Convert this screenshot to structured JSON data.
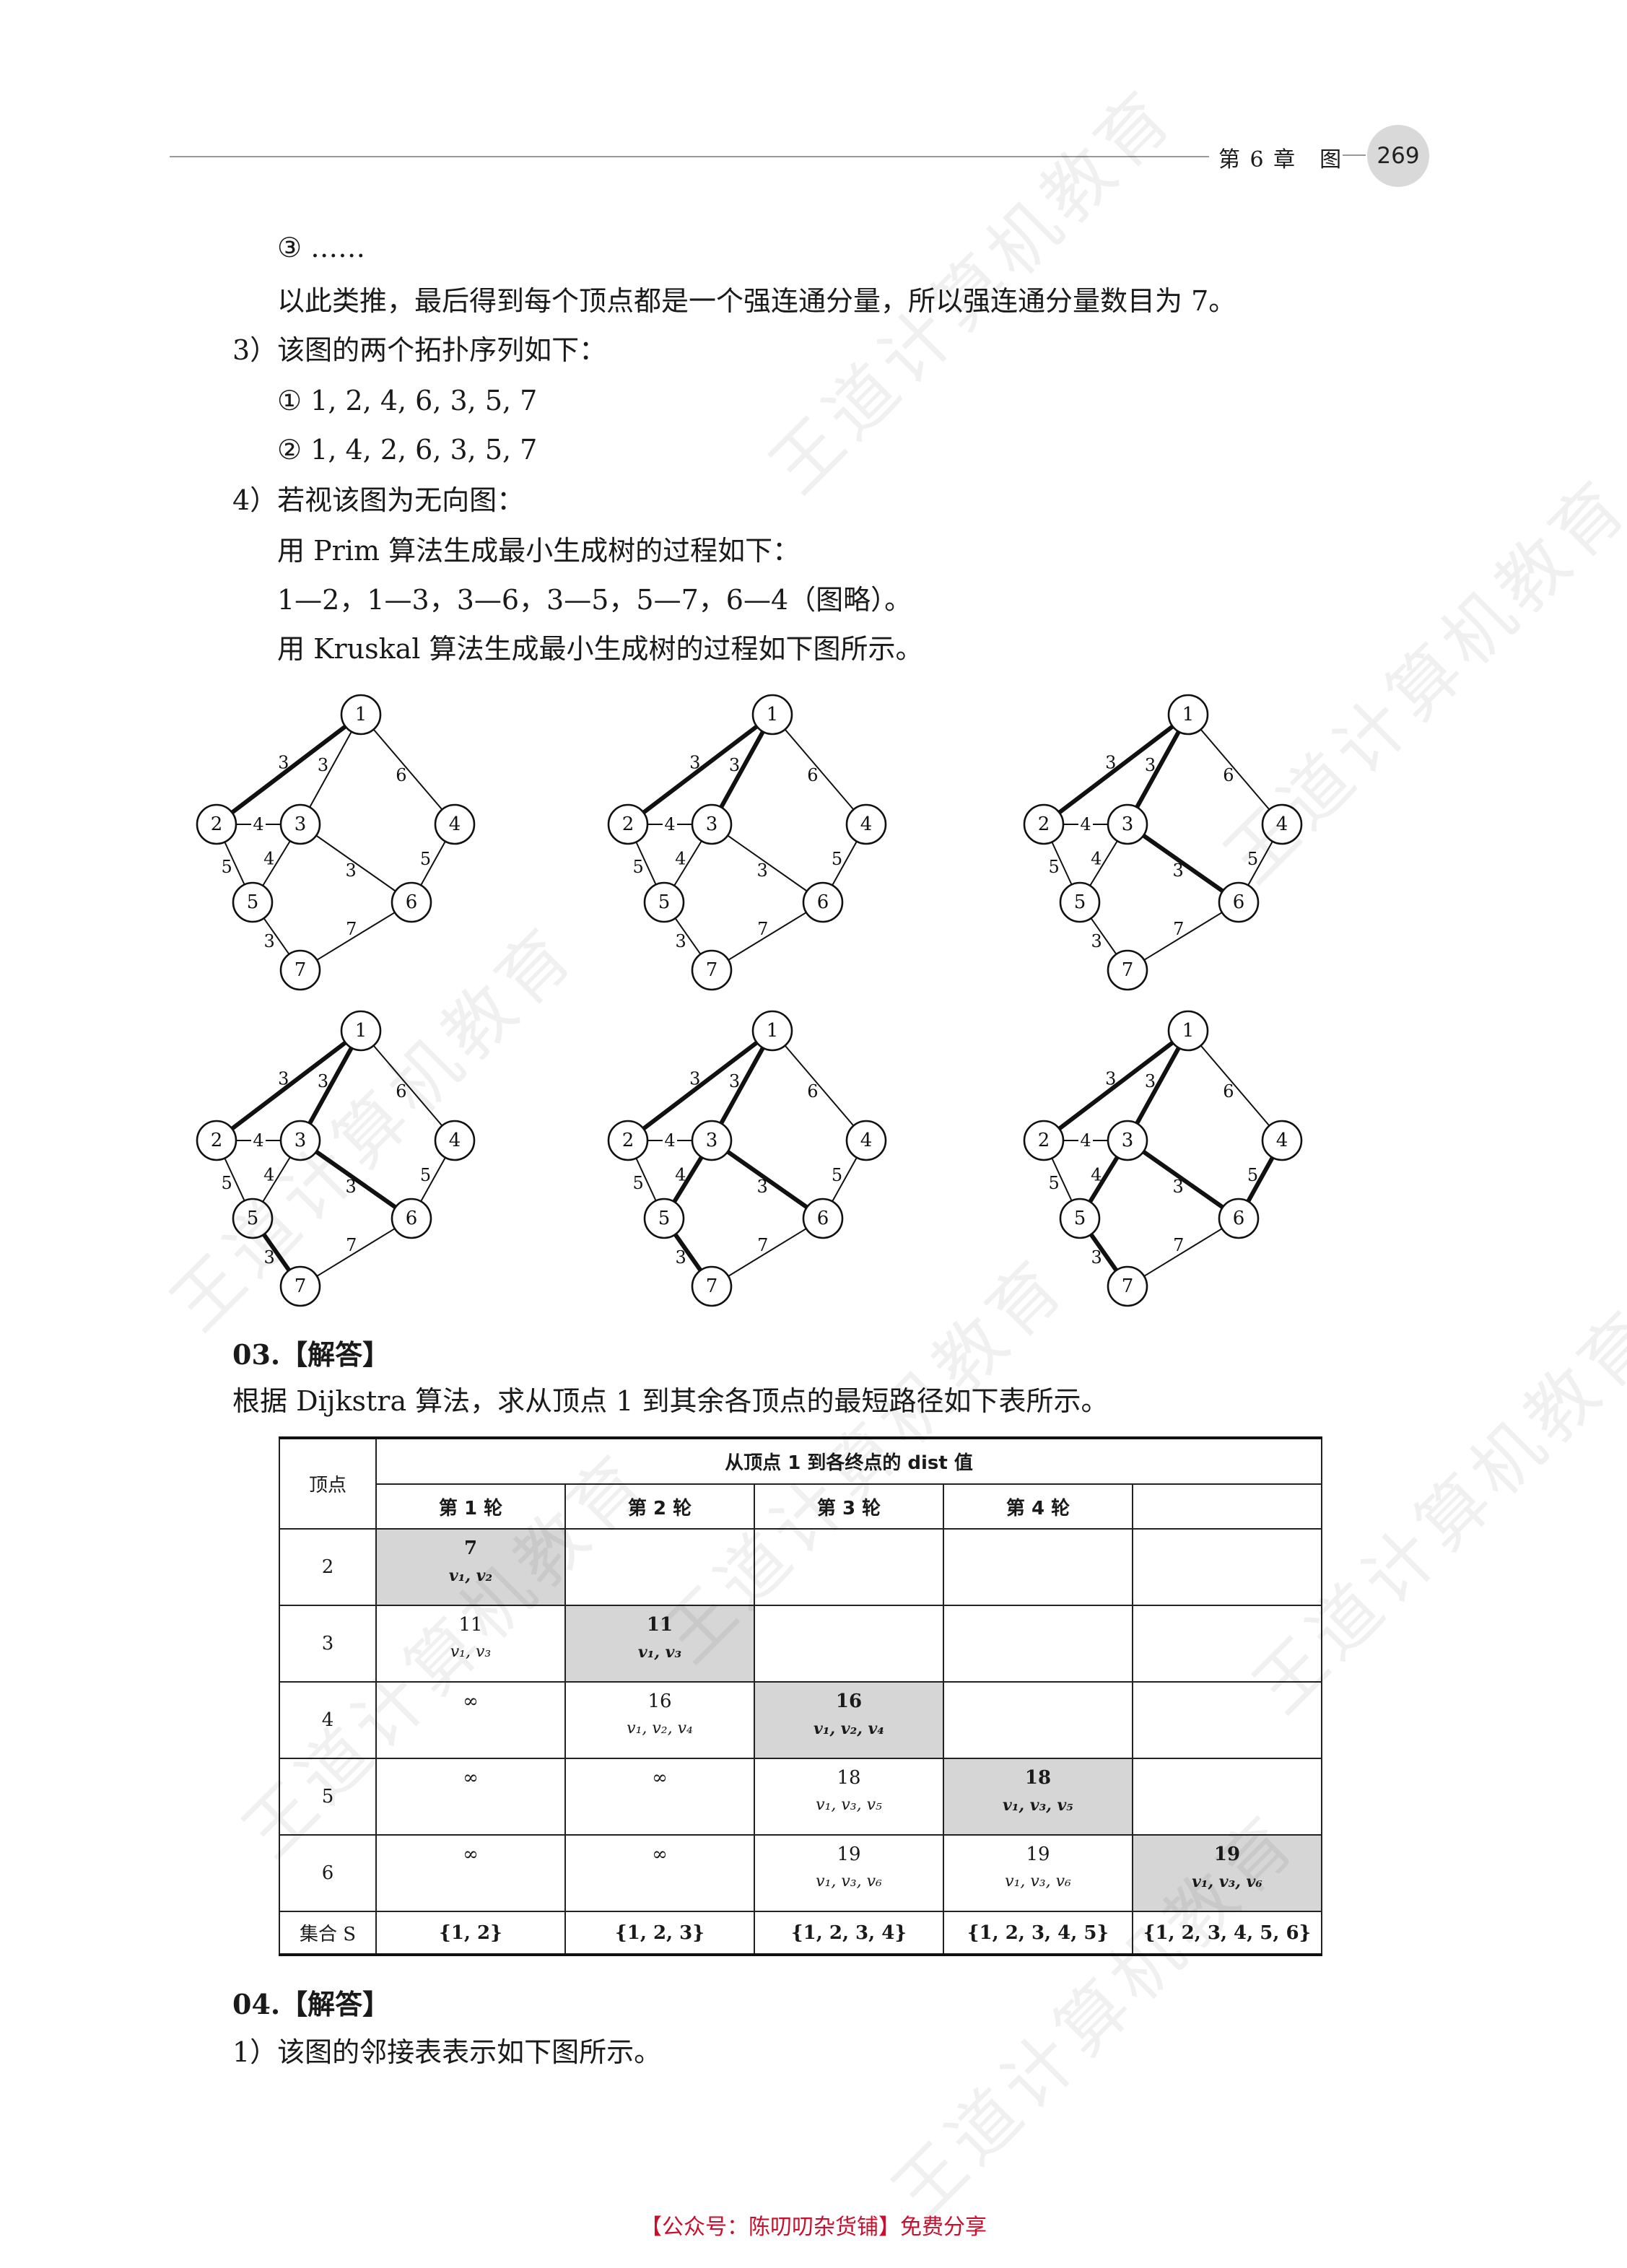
{
  "header": {
    "chapter": "第 6 章　图",
    "page_number": "269"
  },
  "lines": {
    "l1": "③ ……",
    "l2": "以此类推，最后得到每个顶点都是一个强连通分量，所以强连通分量数目为 7。",
    "l3": "3）该图的两个拓扑序列如下：",
    "l4": "① 1, 2, 4, 6, 3, 5, 7",
    "l5": "② 1, 4, 2, 6, 3, 5, 7",
    "l6": "4）若视该图为无向图：",
    "l7": "用 Prim 算法生成最小生成树的过程如下：",
    "l8": "1—2，1—3，3—6，3—5，5—7，6—4（图略）。",
    "l9": "用 Kruskal 算法生成最小生成树的过程如下图所示。",
    "q03": "03.【解答】",
    "q03_text": "根据 Dijkstra 算法，求从顶点 1 到其余各顶点的最短路径如下表所示。",
    "q04": "04.【解答】",
    "q04_text": "1）该图的邻接表表示如下图所示。"
  },
  "graph": {
    "nodes": [
      "1",
      "2",
      "3",
      "4",
      "5",
      "6",
      "7"
    ],
    "edges": [
      {
        "a": "1",
        "b": "2",
        "w": "3"
      },
      {
        "a": "1",
        "b": "3",
        "w": "3"
      },
      {
        "a": "1",
        "b": "4",
        "w": "6"
      },
      {
        "a": "2",
        "b": "3",
        "w": "4"
      },
      {
        "a": "2",
        "b": "5",
        "w": "5"
      },
      {
        "a": "3",
        "b": "5",
        "w": "4"
      },
      {
        "a": "3",
        "b": "6",
        "w": "3"
      },
      {
        "a": "4",
        "b": "6",
        "w": "5"
      },
      {
        "a": "5",
        "b": "7",
        "w": "3"
      },
      {
        "a": "6",
        "b": "7",
        "w": "7"
      }
    ],
    "kruskal_steps": [
      {
        "bold": [
          "1-2"
        ]
      },
      {
        "bold": [
          "1-2",
          "1-3"
        ]
      },
      {
        "bold": [
          "1-2",
          "1-3",
          "3-6"
        ]
      },
      {
        "bold": [
          "1-2",
          "1-3",
          "3-6",
          "5-7"
        ]
      },
      {
        "bold": [
          "1-2",
          "1-3",
          "3-6",
          "5-7",
          "3-5"
        ]
      },
      {
        "bold": [
          "1-2",
          "1-3",
          "3-6",
          "5-7",
          "3-5",
          "4-6"
        ]
      }
    ]
  },
  "table": {
    "vertex_header": "顶点",
    "dist_header": "从顶点 1 到各终点的 dist 值",
    "rounds": [
      "第 1 轮",
      "第 2 轮",
      "第 3 轮",
      "第 4 轮",
      ""
    ],
    "rows": [
      {
        "vertex": "2",
        "cells": [
          {
            "val": "7",
            "path": "v1, v2",
            "shade": true
          },
          {
            "val": "",
            "path": ""
          },
          {
            "val": "",
            "path": ""
          },
          {
            "val": "",
            "path": ""
          },
          {
            "val": "",
            "path": ""
          }
        ]
      },
      {
        "vertex": "3",
        "cells": [
          {
            "val": "11",
            "path": "v1, v3"
          },
          {
            "val": "11",
            "path": "v1, v3",
            "shade": true
          },
          {
            "val": "",
            "path": ""
          },
          {
            "val": "",
            "path": ""
          },
          {
            "val": "",
            "path": ""
          }
        ]
      },
      {
        "vertex": "4",
        "cells": [
          {
            "val": "∞",
            "path": ""
          },
          {
            "val": "16",
            "path": "v1, v2, v4"
          },
          {
            "val": "16",
            "path": "v1, v2, v4",
            "shade": true
          },
          {
            "val": "",
            "path": ""
          },
          {
            "val": "",
            "path": ""
          }
        ]
      },
      {
        "vertex": "5",
        "cells": [
          {
            "val": "∞",
            "path": ""
          },
          {
            "val": "∞",
            "path": ""
          },
          {
            "val": "18",
            "path": "v1, v3, v5"
          },
          {
            "val": "18",
            "path": "v1, v3, v5",
            "shade": true
          },
          {
            "val": "",
            "path": ""
          }
        ]
      },
      {
        "vertex": "6",
        "cells": [
          {
            "val": "∞",
            "path": ""
          },
          {
            "val": "∞",
            "path": ""
          },
          {
            "val": "19",
            "path": "v1, v3, v6"
          },
          {
            "val": "19",
            "path": "v1, v3, v6"
          },
          {
            "val": "19",
            "path": "v1, v3, v6",
            "shade": true
          }
        ]
      }
    ],
    "set_label": "集合 S",
    "sets": [
      "{1, 2}",
      "{1, 2, 3}",
      "{1, 2, 3, 4}",
      "{1, 2, 3, 4, 5}",
      "{1, 2, 3, 4, 5, 6}"
    ]
  },
  "watermark_text": "王道计算机教育",
  "footer": "【公众号：陈叨叨杂货铺】免费分享"
}
